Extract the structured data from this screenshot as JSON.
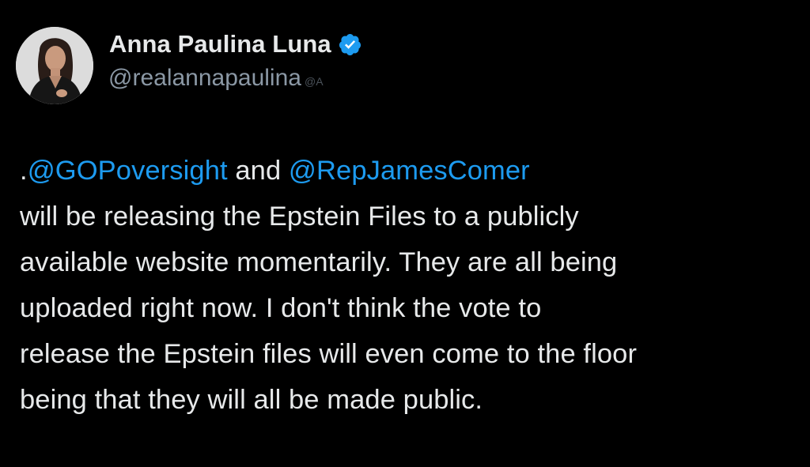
{
  "author": {
    "display_name": "Anna Paulina Luna",
    "handle": "@realannapaulina",
    "handle_fade": "@A",
    "verified": true,
    "avatar_icon": "profile-photo",
    "verified_icon": "verified-badge-icon"
  },
  "tweet": {
    "line1": {
      "prefix": ".",
      "mention1": "@GOPoversight",
      "connector": " and ",
      "mention2": "@RepJamesComer"
    },
    "line2": "will be releasing the Epstein Files to a publicly",
    "line3": "available website momentarily. They are all being",
    "line4": "uploaded right now. I don't think the vote to",
    "line5": "release the Epstein files will even come to the floor",
    "line6": "being that they will all be made public."
  },
  "colors": {
    "background": "#000000",
    "text": "#e7e9ea",
    "secondary_text": "#8b98a5",
    "link": "#1d9bf0",
    "verified": "#1d9bf0"
  }
}
